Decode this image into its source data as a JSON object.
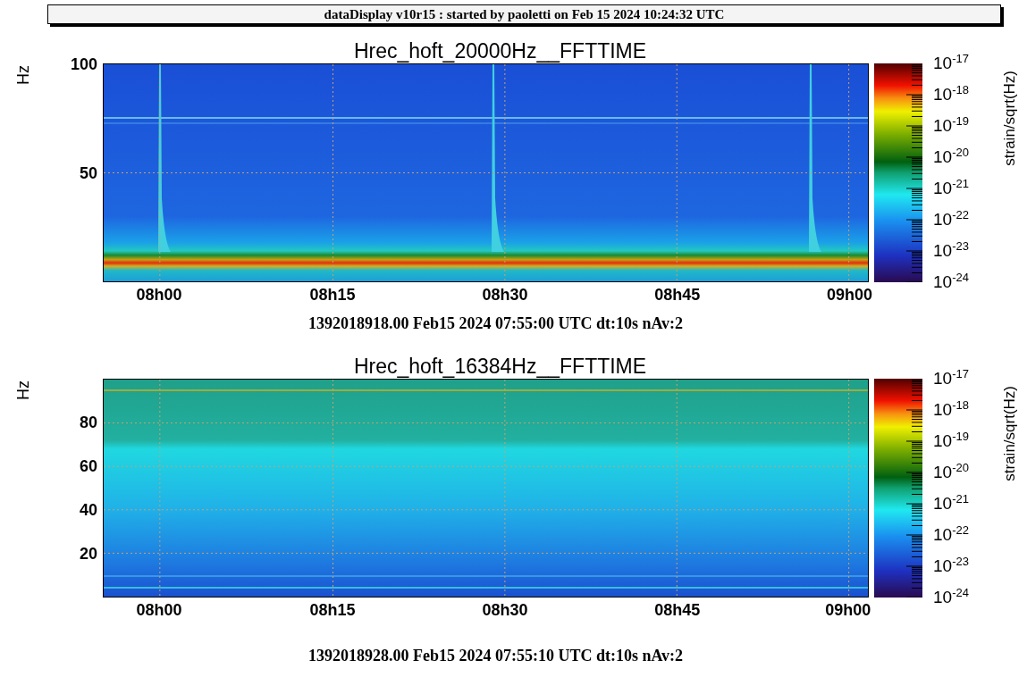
{
  "header": {
    "text": "dataDisplay v10r15 : started by paoletti on Feb 15 2024 10:24:32 UTC"
  },
  "panels": [
    {
      "kind": "glitches",
      "title": "Hrec_hoft_20000Hz__FFTTIME",
      "y_label": "Hz",
      "y_ticks": [
        "100",
        "50"
      ],
      "x_ticks": [
        "08h00",
        "08h15",
        "08h30",
        "08h45",
        "09h00"
      ],
      "colorbar": {
        "label": "strain/sqrt(Hz)",
        "ticks": [
          "10$^{-17}$",
          "10$^{-18}$",
          "10$^{-19}$",
          "10$^{-20}$",
          "10$^{-21}$",
          "10$^{-22}$",
          "10$^{-23}$",
          "10$^{-24}$"
        ]
      },
      "footer": "1392018918.00 Feb15 2024 07:55:00 UTC dt:10s nAv:2"
    },
    {
      "kind": "broadband",
      "title": "Hrec_hoft_16384Hz__FFTTIME",
      "y_label": "Hz",
      "y_ticks": [
        "80",
        "60",
        "40",
        "20"
      ],
      "x_ticks": [
        "08h00",
        "08h15",
        "08h30",
        "08h45",
        "09h00"
      ],
      "colorbar": {
        "label": "strain/sqrt(Hz)",
        "ticks": [
          "10$^{-17}$",
          "10$^{-18}$",
          "10$^{-19}$",
          "10$^{-20}$",
          "10$^{-21}$",
          "10$^{-22}$",
          "10$^{-23}$",
          "10$^{-24}$"
        ]
      },
      "footer": "1392018928.00 Feb15 2024 07:55:10 UTC dt:10s nAv:2"
    }
  ]
}
